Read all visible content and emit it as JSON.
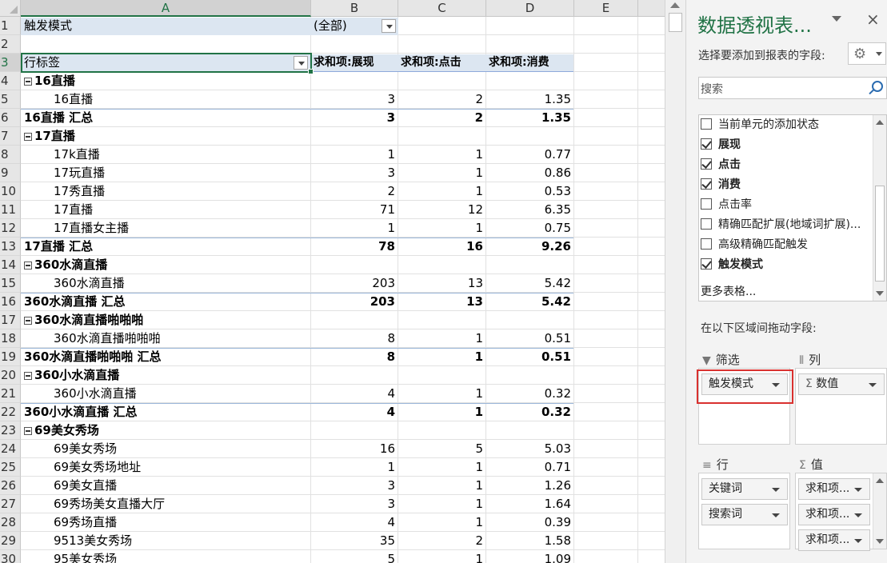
{
  "sheet": {
    "columns": [
      "A",
      "B",
      "C",
      "D",
      "E"
    ],
    "filter_label": "触发模式",
    "filter_value": "(全部)",
    "header": {
      "row_label": "行标签",
      "col_b": "求和项:展现",
      "col_c": "求和项:点击",
      "col_d": "求和项:消费"
    },
    "rows": [
      {
        "n": "1"
      },
      {
        "n": "2"
      },
      {
        "n": "3"
      },
      {
        "n": "4",
        "type": "group",
        "a": "16直播"
      },
      {
        "n": "5",
        "type": "item",
        "a": "16直播",
        "b": "3",
        "c": "2",
        "d": "1.35"
      },
      {
        "n": "6",
        "type": "subtotal",
        "a": "16直播 汇总",
        "b": "3",
        "c": "2",
        "d": "1.35"
      },
      {
        "n": "7",
        "type": "group",
        "a": "17直播"
      },
      {
        "n": "8",
        "type": "item",
        "a": "17k直播",
        "b": "1",
        "c": "1",
        "d": "0.77"
      },
      {
        "n": "9",
        "type": "item",
        "a": "17玩直播",
        "b": "3",
        "c": "1",
        "d": "0.86"
      },
      {
        "n": "10",
        "type": "item",
        "a": "17秀直播",
        "b": "2",
        "c": "1",
        "d": "0.53"
      },
      {
        "n": "11",
        "type": "item",
        "a": "17直播",
        "b": "71",
        "c": "12",
        "d": "6.35"
      },
      {
        "n": "12",
        "type": "item",
        "a": "17直播女主播",
        "b": "1",
        "c": "1",
        "d": "0.75"
      },
      {
        "n": "13",
        "type": "subtotal",
        "a": "17直播 汇总",
        "b": "78",
        "c": "16",
        "d": "9.26"
      },
      {
        "n": "14",
        "type": "group",
        "a": "360水滴直播"
      },
      {
        "n": "15",
        "type": "item",
        "a": "360水滴直播",
        "b": "203",
        "c": "13",
        "d": "5.42"
      },
      {
        "n": "16",
        "type": "subtotal",
        "a": "360水滴直播 汇总",
        "b": "203",
        "c": "13",
        "d": "5.42"
      },
      {
        "n": "17",
        "type": "group",
        "a": "360水滴直播啪啪啪"
      },
      {
        "n": "18",
        "type": "item",
        "a": "360水滴直播啪啪啪",
        "b": "8",
        "c": "1",
        "d": "0.51"
      },
      {
        "n": "19",
        "type": "subtotal",
        "a": "360水滴直播啪啪啪 汇总",
        "b": "8",
        "c": "1",
        "d": "0.51"
      },
      {
        "n": "20",
        "type": "group",
        "a": "360小水滴直播"
      },
      {
        "n": "21",
        "type": "item",
        "a": "360小水滴直播",
        "b": "4",
        "c": "1",
        "d": "0.32"
      },
      {
        "n": "22",
        "type": "subtotal",
        "a": "360小水滴直播 汇总",
        "b": "4",
        "c": "1",
        "d": "0.32"
      },
      {
        "n": "23",
        "type": "group",
        "a": "69美女秀场"
      },
      {
        "n": "24",
        "type": "item",
        "a": "69美女秀场",
        "b": "16",
        "c": "5",
        "d": "5.03"
      },
      {
        "n": "25",
        "type": "item",
        "a": "69美女秀场地址",
        "b": "1",
        "c": "1",
        "d": "0.71"
      },
      {
        "n": "26",
        "type": "item",
        "a": "69美女直播",
        "b": "3",
        "c": "1",
        "d": "1.26"
      },
      {
        "n": "27",
        "type": "item",
        "a": "69秀场美女直播大厅",
        "b": "3",
        "c": "1",
        "d": "1.64"
      },
      {
        "n": "28",
        "type": "item",
        "a": "69秀场直播",
        "b": "4",
        "c": "1",
        "d": "0.39"
      },
      {
        "n": "29",
        "type": "item",
        "a": "9513美女秀场",
        "b": "35",
        "c": "2",
        "d": "1.58"
      },
      {
        "n": "30",
        "type": "item",
        "a": "95美女秀场",
        "b": "5",
        "c": "1",
        "d": "1.09"
      }
    ]
  },
  "panel": {
    "title": "数据透视表...",
    "close": "×",
    "subtitle": "选择要添加到报表的字段:",
    "search_placeholder": "搜索",
    "fields": [
      {
        "label": "当前单元的添加状态",
        "checked": false
      },
      {
        "label": "展现",
        "checked": true
      },
      {
        "label": "点击",
        "checked": true
      },
      {
        "label": "消费",
        "checked": true
      },
      {
        "label": "点击率",
        "checked": false
      },
      {
        "label": "精确匹配扩展(地域词扩展)...",
        "checked": false
      },
      {
        "label": "高级精确匹配触发",
        "checked": false
      },
      {
        "label": "触发模式",
        "checked": true
      }
    ],
    "more_tables": "更多表格...",
    "drag_label": "在以下区域间拖动字段:",
    "areas": {
      "filter": {
        "title": "筛选",
        "items": [
          "触发模式"
        ]
      },
      "columns": {
        "title": "列",
        "items": [
          "数值"
        ]
      },
      "rows": {
        "title": "行",
        "items": [
          "关键词",
          "搜索词"
        ]
      },
      "values": {
        "title": "值",
        "items": [
          "求和项...",
          "求和项...",
          "求和项..."
        ]
      }
    },
    "colors": {
      "accent": "#217346",
      "highlight": "#d9312f",
      "header_fill": "#dce6f1"
    }
  }
}
